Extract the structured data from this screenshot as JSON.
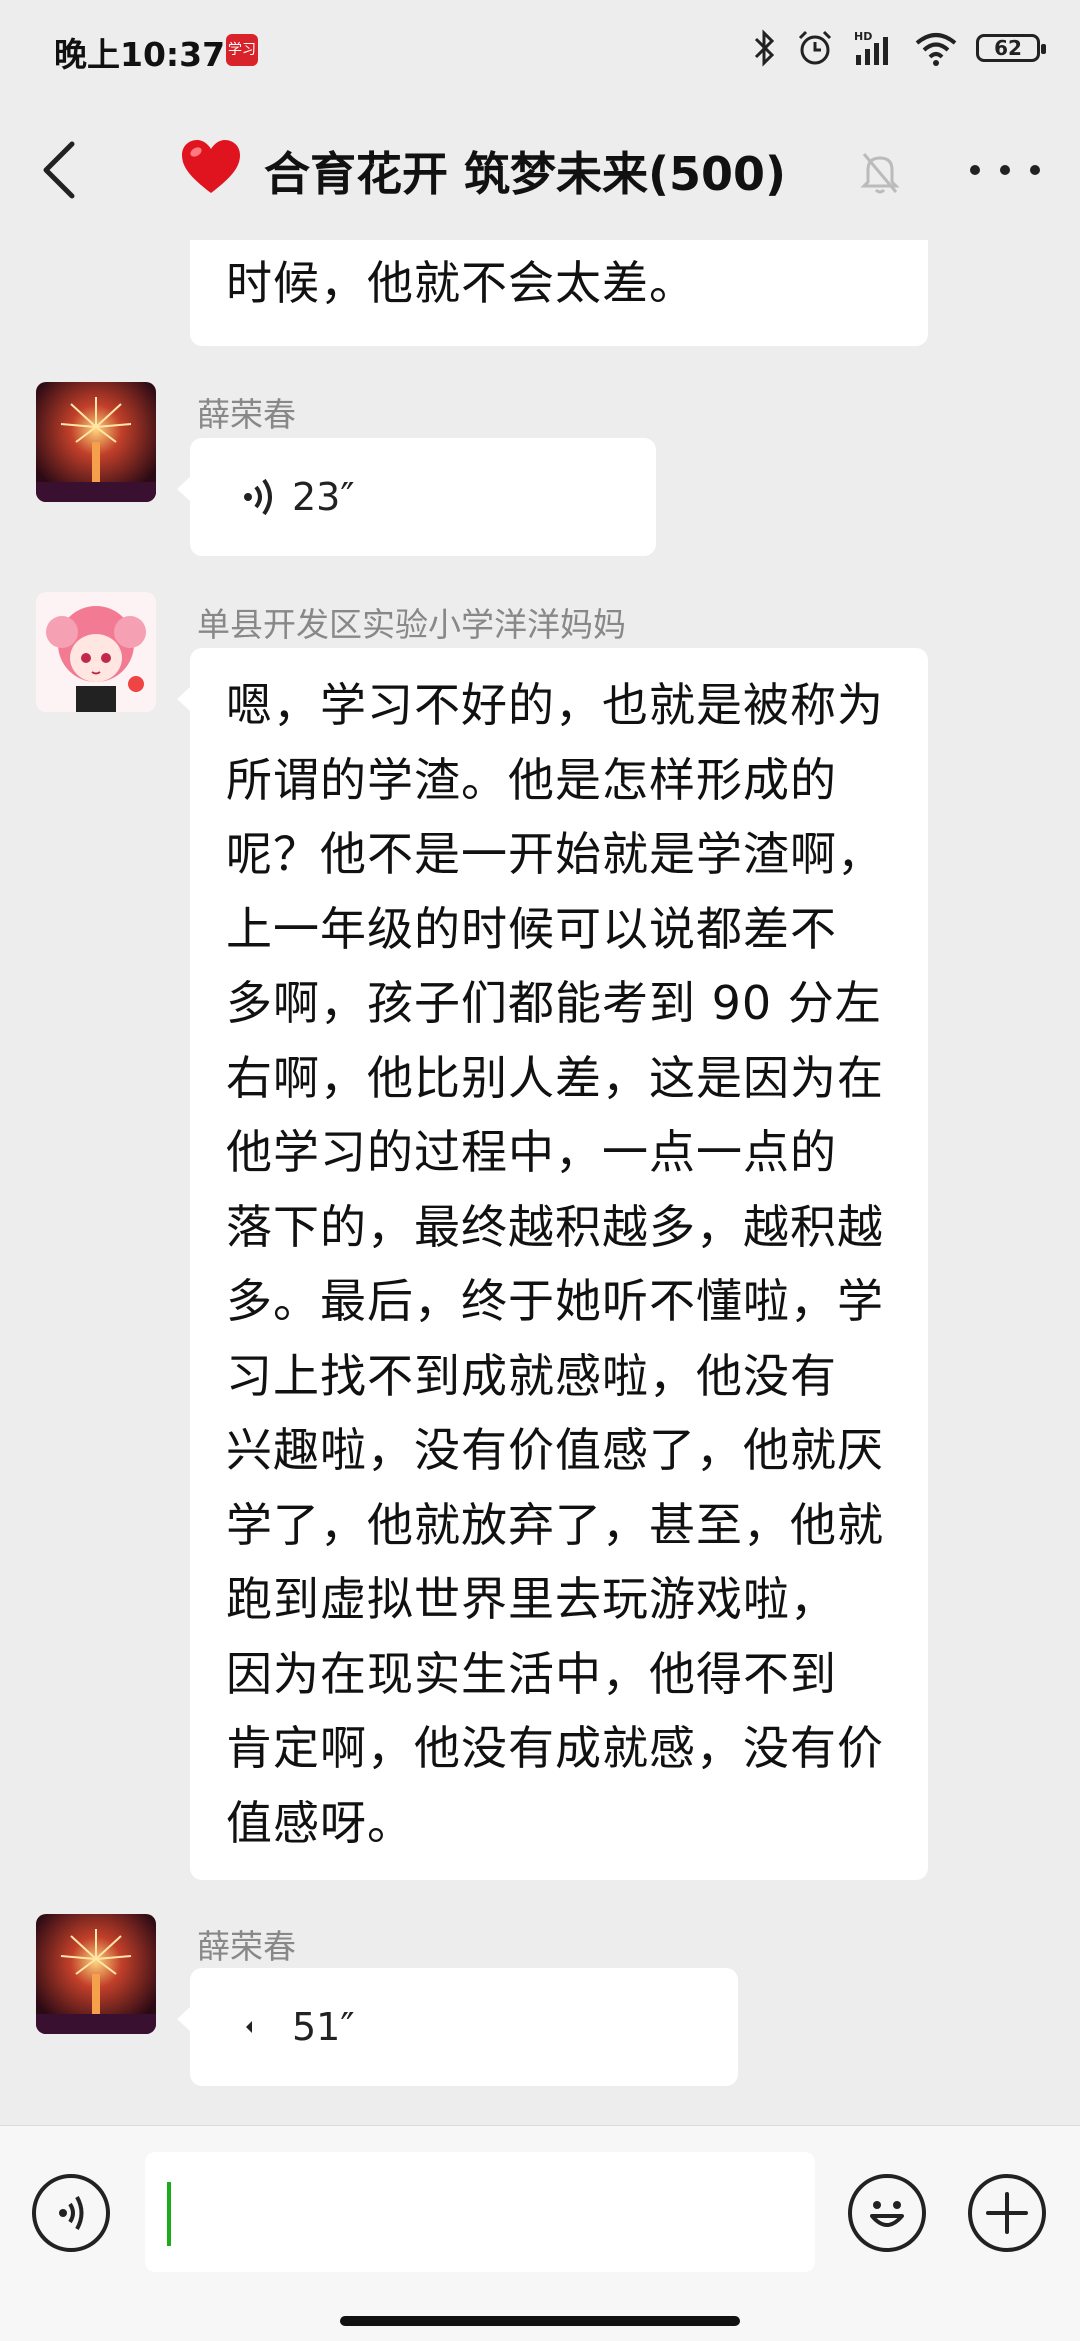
{
  "status_bar": {
    "time": "晚上10:37",
    "app_badge": "学习",
    "battery": "62"
  },
  "header": {
    "title": "合育花开 筑梦未来(500)"
  },
  "messages": [
    {
      "type": "text",
      "text": "时候，他就不会太差。"
    },
    {
      "type": "voice",
      "sender": "薛荣春",
      "duration": "23″"
    },
    {
      "type": "text",
      "sender": "单县开发区实验小学洋洋妈妈",
      "lines": [
        "嗯，学习不好的，也就是被称为",
        "所谓的学渣。他是怎样形成的",
        "呢？他不是一开始就是学渣啊，",
        "上一年级的时候可以说都差不",
        "多啊，孩子们都能考到 90 分左",
        "右啊，他比别人差，这是因为在",
        "他学习的过程中，一点一点的",
        "落下的，最终越积越多，越积越",
        "多。最后，终于她听不懂啦，学",
        "习上找不到成就感啦，他没有",
        "兴趣啦，没有价值感了，他就厌",
        "学了，他就放弃了，甚至，他就",
        "跑到虚拟世界里去玩游戏啦，",
        "因为在现实生活中，他得不到",
        "肯定啊，他没有成就感，没有价",
        "值感呀。"
      ]
    },
    {
      "type": "voice",
      "sender": "薛荣春",
      "duration": "51″"
    }
  ],
  "colors": {
    "background": "#EDEDED",
    "bubble": "#FFFFFF",
    "cursor": "#1AAD19",
    "heart": "#E0141E"
  },
  "icons": {
    "header": [
      "back-arrow-icon",
      "heart-icon",
      "mute-bell-icon",
      "more-icon"
    ],
    "bottom": [
      "voice-input-icon",
      "emoji-icon",
      "plus-icon"
    ]
  }
}
